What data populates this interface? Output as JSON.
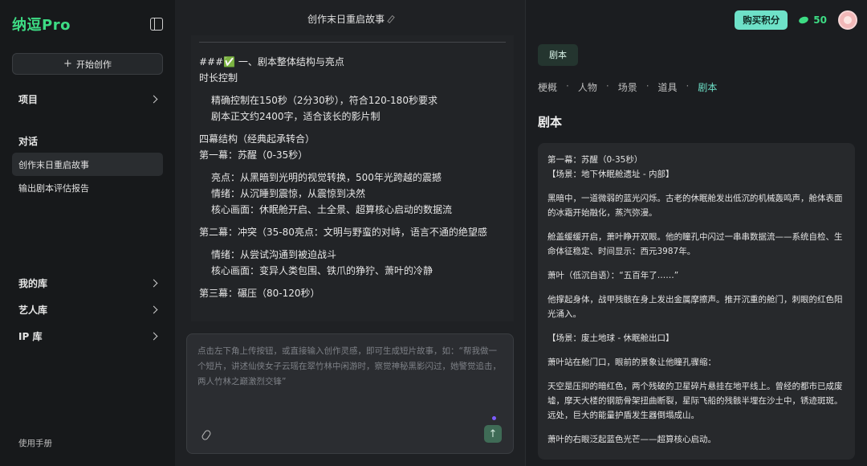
{
  "sidebar": {
    "logo": "纳逗Pro",
    "start_label": "开始创作",
    "projects_label": "项目",
    "conversations_label": "对话",
    "conversations": [
      "创作末日重启故事",
      "输出剧本评估报告"
    ],
    "library_items": [
      "我的库",
      "艺人库",
      "IP 库"
    ],
    "manual_label": "使用手册"
  },
  "middle": {
    "title": "创作末日重启故事",
    "lines": [
      "###✅ 一、剧本整体结构与亮点",
      "时长控制",
      "精确控制在150秒（2分30秒），符合120-180秒要求",
      "剧本正文约2400字，适合该长的影片制",
      "四幕结构（经典起承转合）",
      "第一幕：苏醒（0-35秒）",
      "亮点：从黑暗到光明的视觉转换，500年光跨越的震撼",
      "情绪：从沉睡到震惊，从震惊到决然",
      "核心画面：休眠舱开启、土全景、超算核心启动的数据流",
      "第二幕：冲突（35-80亮点：文明与野蛮的对峙，语言不通的绝望感",
      "情绪：从尝试沟通到被迫战斗",
      "核心画面：变异人类包围、铁爪的狰狞、萧叶的冷静",
      "第三幕：碾压（80-120秒）"
    ],
    "composer_placeholder": "点击左下角上传按钮，或直接输入创作灵感，即可生成短片故事，如：“帮我做一个短片，讲述仙侠女子云瑶在翠竹林中闲游时，察觉神秘黑影闪过，她警觉追击，两人竹林之巅激烈交锋”"
  },
  "right": {
    "buy_label": "购买积分",
    "credits": "50",
    "tag_label": "剧本",
    "tabs": [
      "梗概",
      "人物",
      "场景",
      "道具",
      "剧本"
    ],
    "section_title": "剧本",
    "script_lines": [
      "第一幕：苏醒（0-35秒）",
      "【场景：地下休眠舱遗址 - 内部】",
      "",
      "黑暗中，一道微弱的蓝光闪烁。古老的休眠舱发出低沉的机械轰鸣声，舱体表面的冰霜开始融化，蒸汽弥漫。",
      "",
      "舱盖缓缓开启，萧叶睁开双眼。他的瞳孔中闪过一串串数据流——系统自检、生命体征稳定、时间显示：西元3987年。",
      "",
      "萧叶（低沉自语）：“五百年了……”",
      "",
      "他撑起身体，战甲残骸在身上发出金属摩擦声。推开沉重的舱门，刺眼的红色阳光涌入。",
      "",
      "【场景：废土地球 - 休眠舱出口】",
      "",
      "萧叶站在舱门口，眼前的景象让他瞳孔骤缩：",
      "",
      "天空是压抑的暗红色，两个残破的卫星碎片悬挂在地平线上。曾经的都市已成废墟，摩天大楼的钢筋骨架扭曲断裂，星际飞船的残骸半埋在沙土中，锈迹斑斑。远处，巨大的能量护盾发生器倒塌成山。",
      "",
      "萧叶的右眼泛起蓝色光芒——超算核心启动。"
    ]
  }
}
